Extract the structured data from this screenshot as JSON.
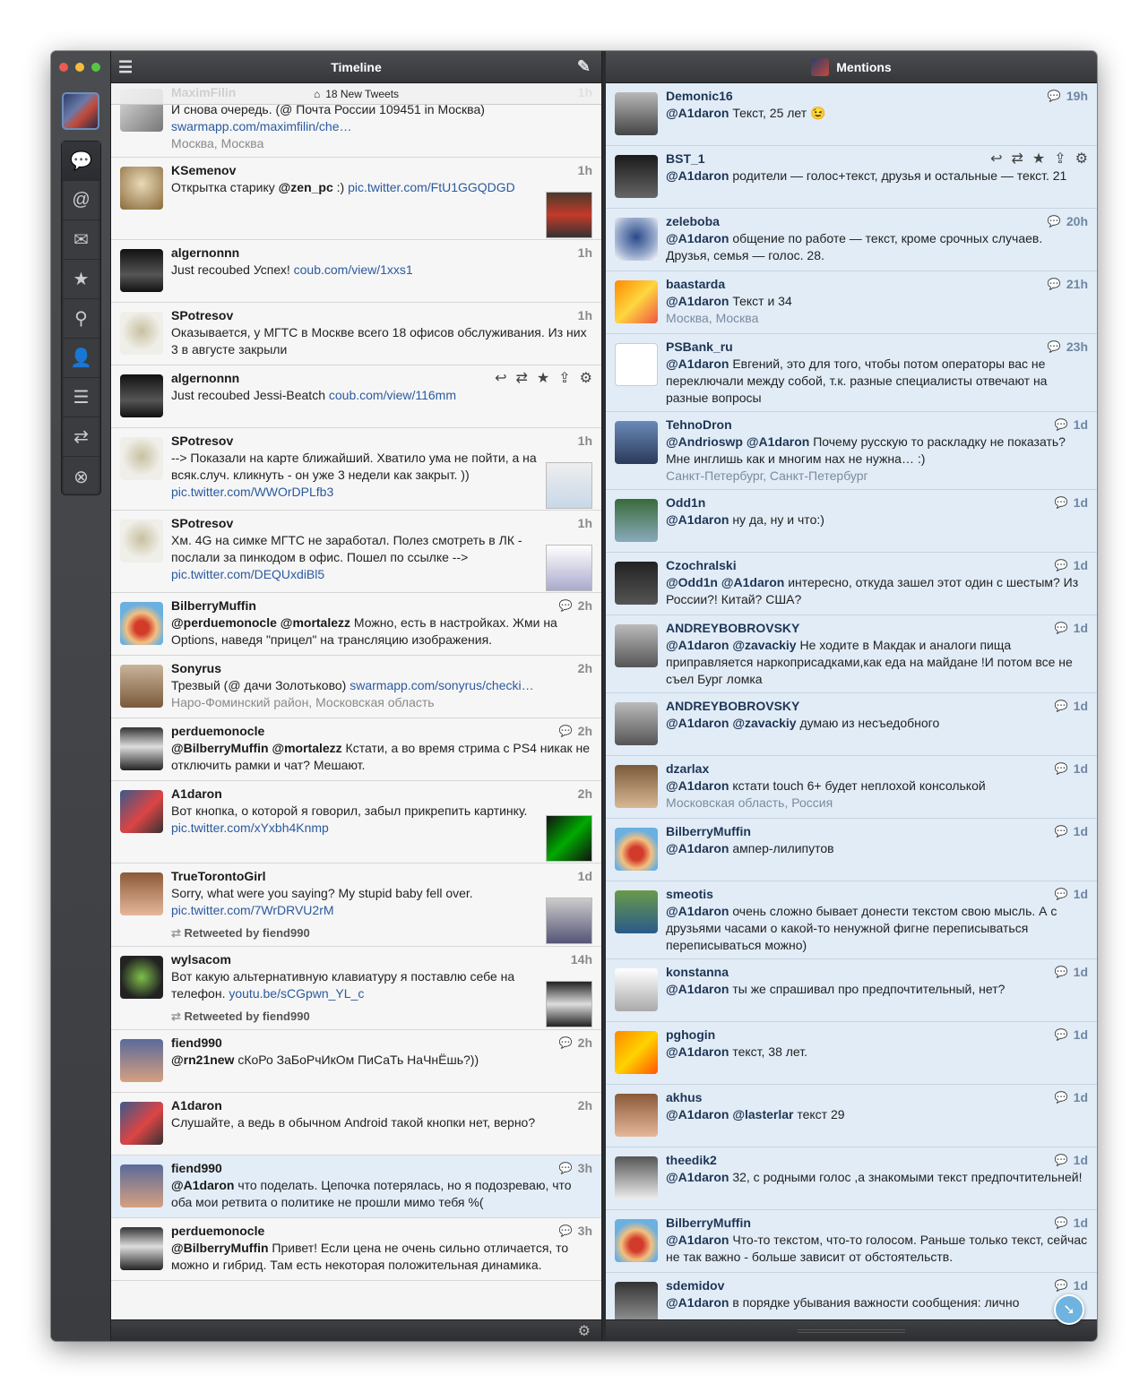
{
  "sidebar": {
    "icons": [
      "list-icon",
      "chat-icon",
      "at-icon",
      "mail-icon",
      "star-icon",
      "search-icon",
      "user-icon",
      "lists-icon",
      "retweet-icon",
      "close-icon"
    ]
  },
  "timeline": {
    "title": "Timeline",
    "new_tweets": "18 New Tweets",
    "tweets": [
      {
        "name": "MaximFilin",
        "time": "1h",
        "parts": [
          {
            "t": "И снова очередь. (@ Почта России 109451 in Москва) "
          },
          {
            "l": "swarmapp.com/maximfilin/che…"
          }
        ],
        "loc": "Москва, Москва",
        "av": "av1"
      },
      {
        "name": "KSemenov",
        "time": "1h",
        "parts": [
          {
            "t": "Открытка старику "
          },
          {
            "m": "@zen_pc"
          },
          {
            "t": " :) "
          },
          {
            "l": "pic.twitter.com/FtU1GGQDGD"
          }
        ],
        "av": "av2",
        "thumb": "th1"
      },
      {
        "name": "algernonnn",
        "time": "1h",
        "parts": [
          {
            "t": "Just recoubed Успех!  "
          },
          {
            "l": "coub.com/view/1xxs1"
          }
        ],
        "av": "av3"
      },
      {
        "name": "SPotresov",
        "time": "1h",
        "parts": [
          {
            "t": "Оказывается, у МГТС в Москве всего 18 офисов обслуживания. Из них 3 в августе закрыли"
          }
        ],
        "av": "av4"
      },
      {
        "name": "algernonnn",
        "time": "",
        "actions": true,
        "parts": [
          {
            "t": "Just recoubed Jessi-Beatch "
          },
          {
            "l": "coub.com/view/116mm"
          }
        ],
        "av": "av3"
      },
      {
        "name": "SPotresov",
        "time": "1h",
        "parts": [
          {
            "t": "--> Показали на карте ближайший. Хватило ума не пойти, а на всяк.случ. кликнуть - он уже 3 недели как закрыт. )) "
          },
          {
            "l": "pic.twitter.com/WWOrDPLfb3"
          }
        ],
        "av": "av4",
        "thumb": "th2"
      },
      {
        "name": "SPotresov",
        "time": "1h",
        "parts": [
          {
            "t": "Хм. 4G на симке МГТС не заработал. Полез смотреть в ЛК - послали за пинкодом в офис. Пошел по ссылке --> "
          },
          {
            "l": "pic.twitter.com/DEQUxdiBl5"
          }
        ],
        "av": "av4",
        "thumb": "th3"
      },
      {
        "name": "BilberryMuffin",
        "time": "2h",
        "conv": true,
        "parts": [
          {
            "m": "@perduemonocle"
          },
          {
            "t": " "
          },
          {
            "m": "@mortalezz"
          },
          {
            "t": " Можно, есть в настройках. Жми на Options, наведя \"прицел\" на трансляцию изображения."
          }
        ],
        "av": "av5"
      },
      {
        "name": "Sonyrus",
        "time": "2h",
        "parts": [
          {
            "t": "Трезвый (@ дачи Золотьково) "
          },
          {
            "l": "swarmapp.com/sonyrus/checki…"
          }
        ],
        "loc": "Наро-Фоминский район, Московская область",
        "av": "av6"
      },
      {
        "name": "perduemonocle",
        "time": "2h",
        "conv": true,
        "parts": [
          {
            "m": "@BilberryMuffin"
          },
          {
            "t": " "
          },
          {
            "m": "@mortalezz"
          },
          {
            "t": " Кстати, а во время стрима с PS4 никак не отключить рамки и чат? Мешают."
          }
        ],
        "av": "av7"
      },
      {
        "name": "A1daron",
        "time": "2h",
        "parts": [
          {
            "t": "Вот кнопка, о которой я говорил, забыл прикрепить картинку. "
          },
          {
            "l": "pic.twitter.com/xYxbh4Knmp"
          }
        ],
        "av": "av8",
        "thumb": "th4"
      },
      {
        "name": "TrueTorontoGirl",
        "time": "1d",
        "parts": [
          {
            "t": "Sorry, what were you saying? My stupid baby fell over. "
          },
          {
            "l": "pic.twitter.com/7WrDRVU2rM"
          }
        ],
        "rt": "Retweeted by fiend990",
        "av": "av9",
        "thumb": "th5"
      },
      {
        "name": "wylsacom",
        "time": "14h",
        "parts": [
          {
            "t": "Вот какую альтернативную клавиатуру я поставлю себе на телефон. "
          },
          {
            "l": "youtu.be/sCGpwn_YL_c"
          }
        ],
        "rt": "Retweeted by fiend990",
        "av": "av10",
        "thumb": "th6"
      },
      {
        "name": "fiend990",
        "time": "2h",
        "conv": true,
        "parts": [
          {
            "m": "@rn21new"
          },
          {
            "t": " сКоРо ЗаБоРчИкОм ПиСаТь НаЧнЁшь?))"
          }
        ],
        "av": "av11"
      },
      {
        "name": "A1daron",
        "time": "2h",
        "parts": [
          {
            "t": "Слушайте, а ведь в обычном Android такой кнопки нет, верно?"
          }
        ],
        "av": "av8"
      },
      {
        "name": "fiend990",
        "time": "3h",
        "conv": true,
        "hl": true,
        "parts": [
          {
            "m": "@A1daron"
          },
          {
            "t": " что поделать. Цепочка потерялась, но я подозреваю, что оба мои ретвита о политике не прошли мимо тебя %("
          }
        ],
        "av": "av11"
      },
      {
        "name": "perduemonocle",
        "time": "3h",
        "conv": true,
        "parts": [
          {
            "m": "@BilberryMuffin"
          },
          {
            "t": " Привет! Если цена не очень сильно отличается, то можно и гибрид. Там есть некоторая положительная динамика."
          }
        ],
        "av": "av7"
      }
    ]
  },
  "mentions": {
    "title": "Mentions",
    "tweets": [
      {
        "name": "Demonic16",
        "time": "19h",
        "conv": true,
        "parts": [
          {
            "m": "@A1daron"
          },
          {
            "t": " Текст, 25 лет 😉"
          }
        ],
        "av": "av12"
      },
      {
        "name": "BST_1",
        "time": "",
        "actions": true,
        "parts": [
          {
            "m": "@A1daron"
          },
          {
            "t": " родители — голос+текст, друзья и остальные — текст. 21"
          }
        ],
        "av": "av13"
      },
      {
        "name": "zeleboba",
        "time": "20h",
        "conv": true,
        "parts": [
          {
            "m": "@A1daron"
          },
          {
            "t": " общение по работе — текст, кроме срочных случаев. Друзья, семья — голос. 28."
          }
        ],
        "av": "av14"
      },
      {
        "name": "baastarda",
        "time": "21h",
        "conv": true,
        "parts": [
          {
            "m": "@A1daron"
          },
          {
            "t": " Текст и 34"
          }
        ],
        "loc": "Москва, Москва",
        "av": "av15"
      },
      {
        "name": "PSBank_ru",
        "time": "23h",
        "conv": true,
        "parts": [
          {
            "m": "@A1daron"
          },
          {
            "t": " Евгений, это для того, чтобы потом операторы вас не переключали между собой, т.к. разные специалисты отвечают на разные вопросы"
          }
        ],
        "av": "av16"
      },
      {
        "name": "TehnoDron",
        "time": "1d",
        "conv": true,
        "parts": [
          {
            "m": "@Andrioswp"
          },
          {
            "t": " "
          },
          {
            "m": "@A1daron"
          },
          {
            "t": " Почему русскую то раскладку не показать? Мне инглишь как и многим нах не нужна… :)"
          }
        ],
        "loc": "Санкт-Петербург, Санкт-Петербург",
        "av": "av17"
      },
      {
        "name": "Odd1n",
        "time": "1d",
        "conv": true,
        "parts": [
          {
            "m": "@A1daron"
          },
          {
            "t": " ну да, ну и что:)"
          }
        ],
        "av": "av18"
      },
      {
        "name": "Czochralski",
        "time": "1d",
        "conv": true,
        "parts": [
          {
            "m": "@Odd1n"
          },
          {
            "t": " "
          },
          {
            "m": "@A1daron"
          },
          {
            "t": " интересно, откуда зашел этот один с шестым? Из России?! Китай?  США?"
          }
        ],
        "av": "av19"
      },
      {
        "name": "ANDREYBOBROVSKY",
        "time": "1d",
        "conv": true,
        "parts": [
          {
            "m": "@A1daron"
          },
          {
            "t": " "
          },
          {
            "m": "@zavackiy"
          },
          {
            "t": " Не ходите в Макдак и аналоги пища приправляется наркоприсадками,как еда на майдане !И потом все не съел Бург ломка"
          }
        ],
        "av": "av20"
      },
      {
        "name": "ANDREYBOBROVSKY",
        "time": "1d",
        "conv": true,
        "parts": [
          {
            "m": "@A1daron"
          },
          {
            "t": " "
          },
          {
            "m": "@zavackiy"
          },
          {
            "t": " думаю из несъедобного"
          }
        ],
        "av": "av20"
      },
      {
        "name": "dzarlax",
        "time": "1d",
        "conv": true,
        "parts": [
          {
            "m": "@A1daron"
          },
          {
            "t": " кстати touch 6+ будет неплохой консолькой"
          }
        ],
        "loc": "Московская область, Россия",
        "av": "av24"
      },
      {
        "name": "BilberryMuffin",
        "time": "1d",
        "conv": true,
        "parts": [
          {
            "m": "@A1daron"
          },
          {
            "t": " ампер-лилипутов"
          }
        ],
        "av": "av5"
      },
      {
        "name": "smeotis",
        "time": "1d",
        "conv": true,
        "parts": [
          {
            "m": "@A1daron"
          },
          {
            "t": " очень сложно бывает донести текстом свою мысль. А с друзьями часами о какой-то ненужной фигне переписываться переписываться можно)"
          }
        ],
        "av": "av21"
      },
      {
        "name": "konstanna",
        "time": "1d",
        "conv": true,
        "parts": [
          {
            "m": "@A1daron"
          },
          {
            "t": " ты же спрашивал про предпочтительный, нет?"
          }
        ],
        "av": "av22"
      },
      {
        "name": "pghogin",
        "time": "1d",
        "conv": true,
        "parts": [
          {
            "m": "@A1daron"
          },
          {
            "t": " текст, 38 лет."
          }
        ],
        "av": "av23"
      },
      {
        "name": "akhus",
        "time": "1d",
        "conv": true,
        "parts": [
          {
            "m": "@A1daron"
          },
          {
            "t": " "
          },
          {
            "m": "@lasterlar"
          },
          {
            "t": " текст 29"
          }
        ],
        "av": "av9"
      },
      {
        "name": "theedik2",
        "time": "1d",
        "conv": true,
        "parts": [
          {
            "m": "@A1daron"
          },
          {
            "t": " 32, с родными голос ,а знакомыми текст предпочтительней!"
          }
        ],
        "av": "av25"
      },
      {
        "name": "BilberryMuffin",
        "time": "1d",
        "conv": true,
        "parts": [
          {
            "m": "@A1daron"
          },
          {
            "t": " Что-то текстом, что-то голосом. Раньше только текст, сейчас не так важно - больше зависит от обстоятельств."
          }
        ],
        "av": "av5"
      },
      {
        "name": "sdemidov",
        "time": "1d",
        "conv": true,
        "parts": [
          {
            "m": "@A1daron"
          },
          {
            "t": " в порядке убывания важности сообщения: лично"
          }
        ],
        "av": "av26"
      }
    ]
  }
}
